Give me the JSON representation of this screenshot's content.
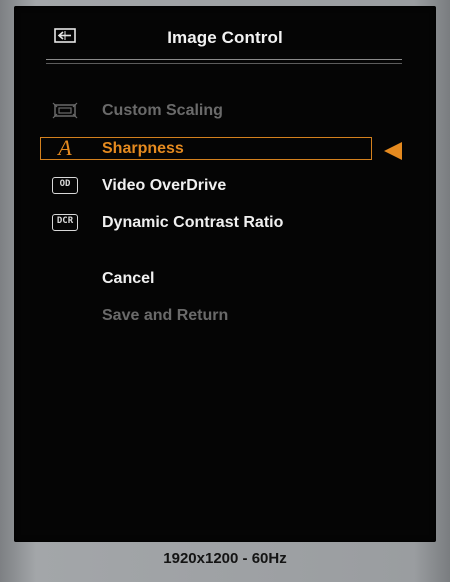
{
  "header": {
    "title": "Image Control",
    "icon": "input-arrow-icon"
  },
  "menu": {
    "items": [
      {
        "label": "Custom Scaling",
        "icon": "custom-scaling-icon",
        "state": "disabled"
      },
      {
        "label": "Sharpness",
        "icon": "sharpness-icon",
        "icon_text": "A",
        "state": "selected"
      },
      {
        "label": "Video OverDrive",
        "icon": "od-icon",
        "icon_text": "OD",
        "state": "enabled"
      },
      {
        "label": "Dynamic Contrast Ratio",
        "icon": "dcr-icon",
        "icon_text": "DCR",
        "state": "enabled"
      }
    ],
    "cancel_label": "Cancel",
    "save_label": "Save and Return",
    "save_state": "disabled"
  },
  "status": {
    "resolution": "1920x1200 - 60Hz"
  },
  "colors": {
    "accent": "#e58a1f",
    "text": "#f0f0f0",
    "disabled_text": "#6a6a6a",
    "background": "#050505",
    "bezel": "#9a9da0"
  }
}
